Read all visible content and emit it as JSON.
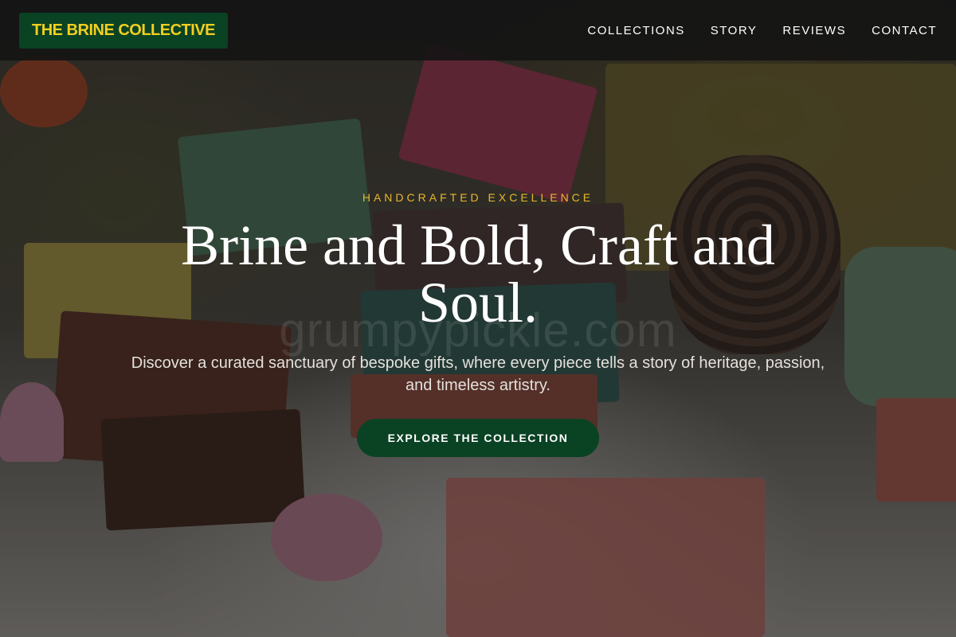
{
  "header": {
    "logo_text": "THE BRINE COLLECTIVE",
    "nav": [
      {
        "label": "COLLECTIONS"
      },
      {
        "label": "STORY"
      },
      {
        "label": "REVIEWS"
      },
      {
        "label": "CONTACT"
      }
    ]
  },
  "hero": {
    "eyebrow": "HANDCRAFTED EXCELLENCE",
    "headline": "Brine and Bold, Craft and Soul.",
    "subtext": "Discover a curated sanctuary of bespoke gifts, where every piece tells a story of heritage, passion, and timeless artistry.",
    "cta_label": "EXPLORE THE COLLECTION",
    "watermark": "grumpypickle.com"
  },
  "colors": {
    "brand_green": "#0a4224",
    "brand_gold": "#f2cf1f",
    "eyebrow_gold": "#e7b82a"
  }
}
